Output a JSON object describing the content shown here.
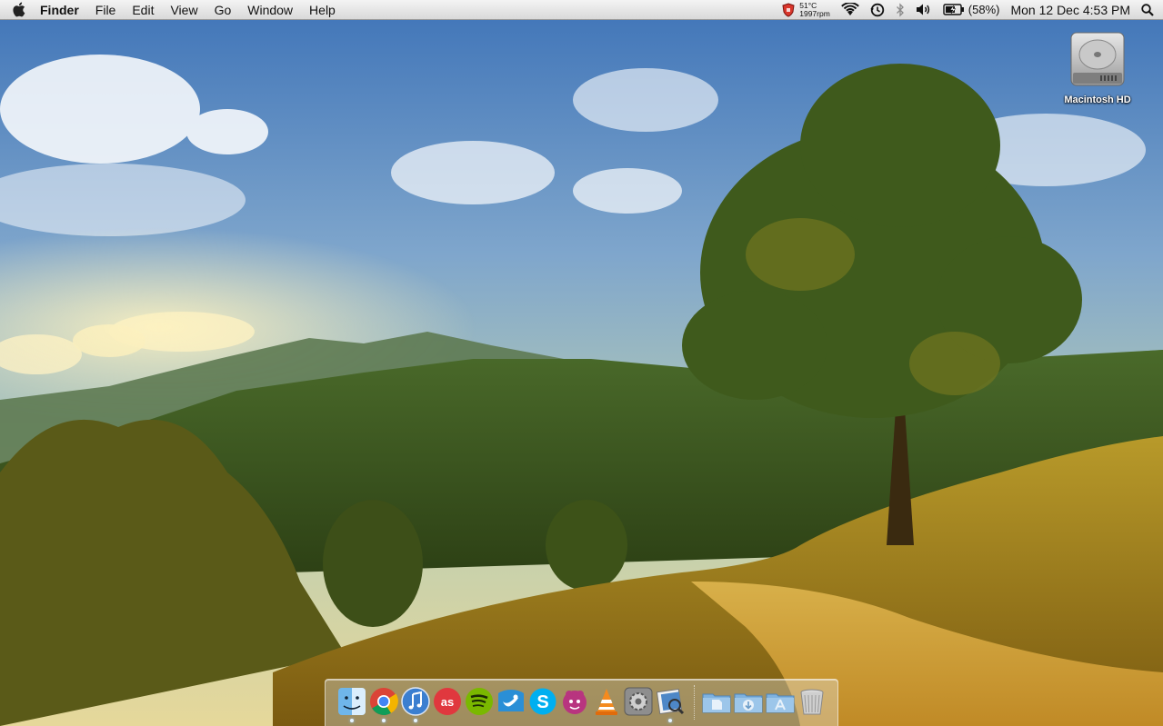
{
  "menubar": {
    "app_name": "Finder",
    "menus": [
      "File",
      "Edit",
      "View",
      "Go",
      "Window",
      "Help"
    ],
    "status": {
      "temperature": "51°C",
      "fan_speed": "1997rpm",
      "battery_percent": "(58%)",
      "clock": "Mon 12 Dec  4:53 PM"
    },
    "icons": [
      "apple-icon",
      "security-shield-icon",
      "wifi-icon",
      "time-machine-icon",
      "bluetooth-icon",
      "volume-icon",
      "battery-icon",
      "spotlight-search-icon"
    ]
  },
  "desktop": {
    "icons": [
      {
        "label": "Macintosh HD",
        "icon": "hard-drive-icon"
      }
    ]
  },
  "dock": {
    "apps": [
      {
        "name": "Finder",
        "icon": "finder-icon",
        "running": true
      },
      {
        "name": "Google Chrome",
        "icon": "chrome-icon",
        "running": true
      },
      {
        "name": "iTunes",
        "icon": "itunes-icon",
        "running": true
      },
      {
        "name": "Last.fm",
        "icon": "lastfm-icon",
        "running": false
      },
      {
        "name": "Spotify",
        "icon": "spotify-icon",
        "running": false
      },
      {
        "name": "Twitter",
        "icon": "twitter-icon",
        "running": false
      },
      {
        "name": "Skype",
        "icon": "skype-icon",
        "running": false
      },
      {
        "name": "Growl",
        "icon": "growl-icon",
        "running": false
      },
      {
        "name": "VLC",
        "icon": "vlc-icon",
        "running": false
      },
      {
        "name": "System Preferences",
        "icon": "system-preferences-icon",
        "running": false
      },
      {
        "name": "Preview",
        "icon": "preview-icon",
        "running": true
      }
    ],
    "stacks": [
      {
        "name": "Documents",
        "icon": "documents-folder-icon"
      },
      {
        "name": "Downloads",
        "icon": "downloads-folder-icon"
      },
      {
        "name": "Applications",
        "icon": "applications-folder-icon"
      },
      {
        "name": "Trash",
        "icon": "trash-icon"
      }
    ]
  }
}
